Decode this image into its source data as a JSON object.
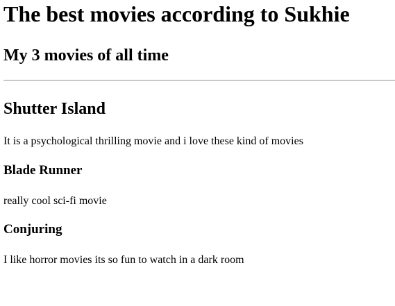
{
  "page": {
    "title": "The best movies according to Sukhie",
    "subtitle": "My 3 movies of all time"
  },
  "movies": [
    {
      "title": "Shutter Island",
      "description": "It is a psychological thrilling movie and i love these kind of movies"
    },
    {
      "title": "Blade Runner",
      "description": "really cool sci-fi movie"
    },
    {
      "title": "Conjuring",
      "description": "I like horror movies its so fun to watch in a dark room"
    }
  ]
}
